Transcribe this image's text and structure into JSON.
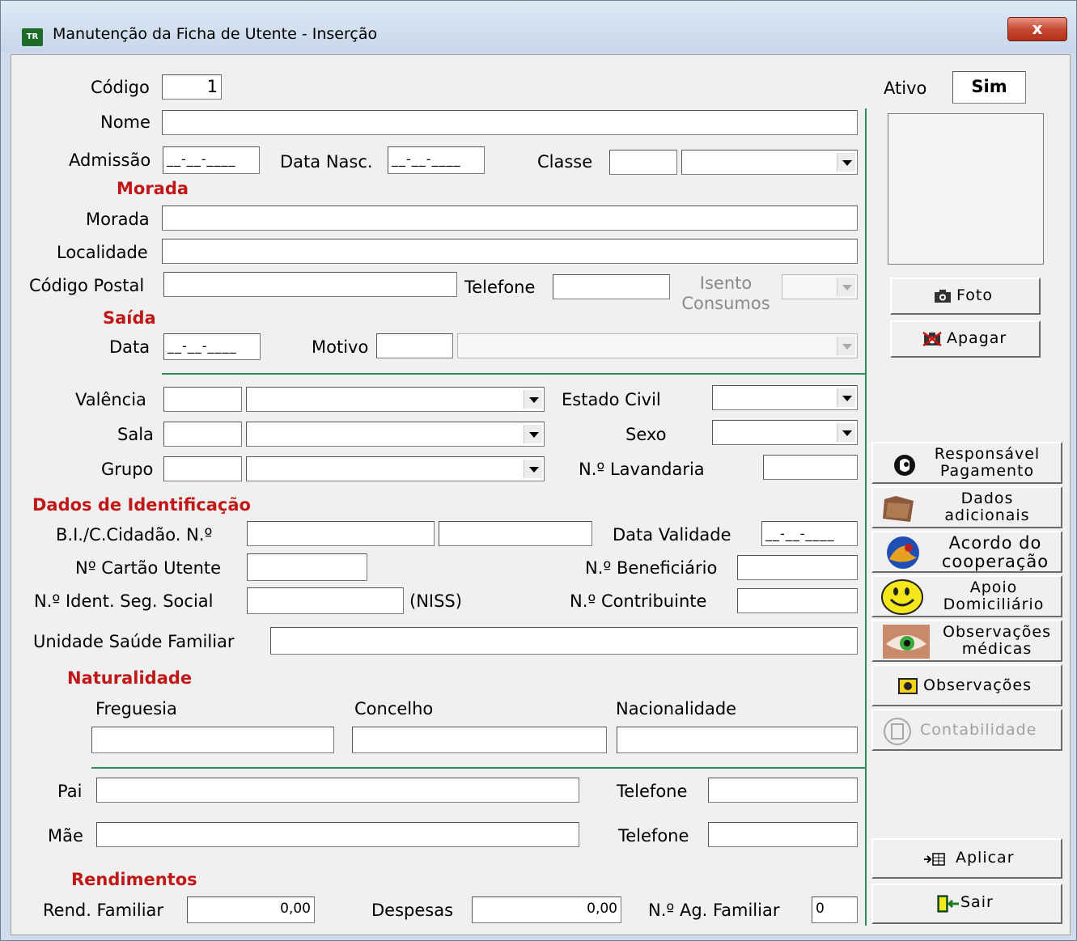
{
  "window": {
    "title": "Manutenção da Ficha de Utente - Inserção",
    "icon_text": "TR",
    "close_label": "x"
  },
  "labels": {
    "codigo": "Código",
    "nome": "Nome",
    "admissao": "Admissão",
    "data_nasc": "Data Nasc.",
    "classe": "Classe",
    "morada": "Morada",
    "localidade": "Localidade",
    "codigo_postal": "Código Postal",
    "telefone": "Telefone",
    "isento_line1": "Isento",
    "isento_line2": "Consumos",
    "data": "Data",
    "motivo": "Motivo",
    "valencia": "Valência",
    "sala": "Sala",
    "grupo": "Grupo",
    "estado_civil": "Estado Civil",
    "sexo": "Sexo",
    "lavandaria": "N.º Lavandaria",
    "bi": "B.I./C.Cidadão. N.º",
    "data_validade": "Data Validade",
    "cartao_utente": "Nº Cartão Utente",
    "beneficiario": "N.º Beneficiário",
    "seg_social": "N.º Ident. Seg. Social",
    "niss": "(NISS)",
    "contribuinte": "N.º Contribuinte",
    "usf": "Unidade Saúde Familiar",
    "freguesia": "Freguesia",
    "concelho": "Concelho",
    "nacionalidade": "Nacionalidade",
    "pai": "Pai",
    "mae": "Mãe",
    "telefone_pai": "Telefone",
    "telefone_mae": "Telefone",
    "rend_familiar": "Rend. Familiar",
    "despesas": "Despesas",
    "ag_familiar": "N.º Ag. Familiar",
    "ativo": "Ativo"
  },
  "sections": {
    "morada": "Morada",
    "saida": "Saída",
    "identificacao": "Dados de Identificação",
    "naturalidade": "Naturalidade",
    "rendimentos": "Rendimentos"
  },
  "values": {
    "codigo": "1",
    "admissao": "__-__-____",
    "data_nasc": "__-__-____",
    "saida_data": "__-__-____",
    "data_validade": "__-__-____",
    "ativo": "Sim",
    "rend_familiar": "0,00",
    "despesas": "0,00",
    "ag_familiar": "0"
  },
  "buttons": {
    "foto": "Foto",
    "apagar": "Apagar",
    "responsavel_1": "Responsável",
    "responsavel_2": "Pagamento",
    "dados_1": "Dados",
    "dados_2": "adicionais",
    "acordo_1": "Acordo do",
    "acordo_2": "cooperação",
    "apoio_1": "Apoio",
    "apoio_2": "Domiciliário",
    "obs_med_1": "Observações",
    "obs_med_2": "médicas",
    "observacoes": "Observações",
    "contabilidade": "Contabilidade",
    "aplicar": "Aplicar",
    "sair": "Sair"
  },
  "colors": {
    "section_red": "#c01818",
    "divider_green": "#2e8b57",
    "face": "#f0f0f0"
  }
}
